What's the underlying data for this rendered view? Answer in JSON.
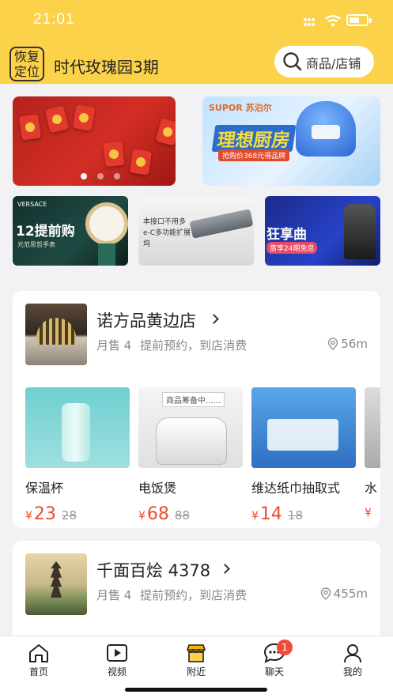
{
  "status_bar": {
    "time": "21:01"
  },
  "header": {
    "relocate_label": "恢复定位",
    "location": "时代玫瑰园3期",
    "search_placeholder": "商品/店铺"
  },
  "banners": [
    {
      "name": "red-envelope-banner"
    },
    {
      "name": "supor-banner",
      "brand": "SUPOR 苏泊尔",
      "title": "理想厨房",
      "subtitle": "抢购价368元得品牌"
    }
  ],
  "promos": [
    {
      "brand": "VERSACE",
      "title": "12提前购",
      "subtitle": "元范思哲手表"
    },
    {
      "text": "本接口不用多 e-C多功能扩展坞"
    },
    {
      "title": "狂享曲",
      "subtitle": "蔷享24期免息"
    }
  ],
  "stores": [
    {
      "name": "诺方品黄边店",
      "monthly_sales": "月售 4",
      "service": "提前预约，到店消费",
      "distance": "56m",
      "products": [
        {
          "name": "保温杯",
          "price": "23",
          "original_price": "28"
        },
        {
          "name": "电饭煲",
          "price": "68",
          "original_price": "88",
          "tag": "商品筹备中......"
        },
        {
          "name": "维达纸巾抽取式",
          "price": "14",
          "original_price": "18"
        },
        {
          "name": "水",
          "price": "",
          "original_price": ""
        }
      ]
    },
    {
      "name": "千面百烩 4378",
      "monthly_sales": "月售 4",
      "service": "提前预约，到店消费",
      "distance": "455m"
    }
  ],
  "currency_symbol": "¥",
  "tabbar": [
    {
      "label": "首页",
      "icon": "home-icon"
    },
    {
      "label": "视频",
      "icon": "video-icon"
    },
    {
      "label": "附近",
      "icon": "store-icon"
    },
    {
      "label": "聊天",
      "icon": "chat-icon",
      "badge": "1"
    },
    {
      "label": "我的",
      "icon": "profile-icon"
    }
  ],
  "colors": {
    "header_bg": "#fbd24a",
    "price": "#f04a2c",
    "badge": "#f04a3a"
  }
}
